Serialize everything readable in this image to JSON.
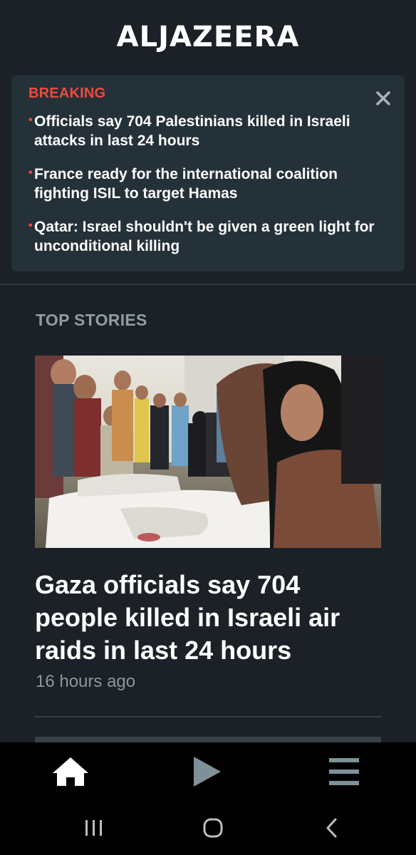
{
  "header": {
    "logo_text": "ALJAZEERA"
  },
  "breaking": {
    "label": "BREAKING",
    "close_icon": "close-icon",
    "items": [
      {
        "text": "Officials say 704 Palestinians killed in Israeli attacks in last 24 hours"
      },
      {
        "text": "France ready for the international coalition fighting ISIL to target Hamas"
      },
      {
        "text": "Qatar: Israel shouldn't be given a green light for unconditional killing"
      }
    ]
  },
  "top_stories": {
    "title": "TOP STORIES",
    "lead": {
      "headline": "Gaza officials say 704 people killed in Israeli air raids in last 24 hours",
      "time": "16 hours ago"
    }
  },
  "bottom_nav": {
    "items": [
      {
        "icon": "home-icon"
      },
      {
        "icon": "play-icon"
      },
      {
        "icon": "menu-icon"
      }
    ]
  },
  "system_nav": {
    "items": [
      {
        "icon": "recent-apps-icon"
      },
      {
        "icon": "home-circle-icon"
      },
      {
        "icon": "back-icon"
      }
    ]
  },
  "colors": {
    "background": "#1b2126",
    "breaking_panel": "#253138",
    "breaking_accent": "#ef4a3d",
    "muted_text": "#8c979d",
    "nav_icon": "#7f9198"
  }
}
